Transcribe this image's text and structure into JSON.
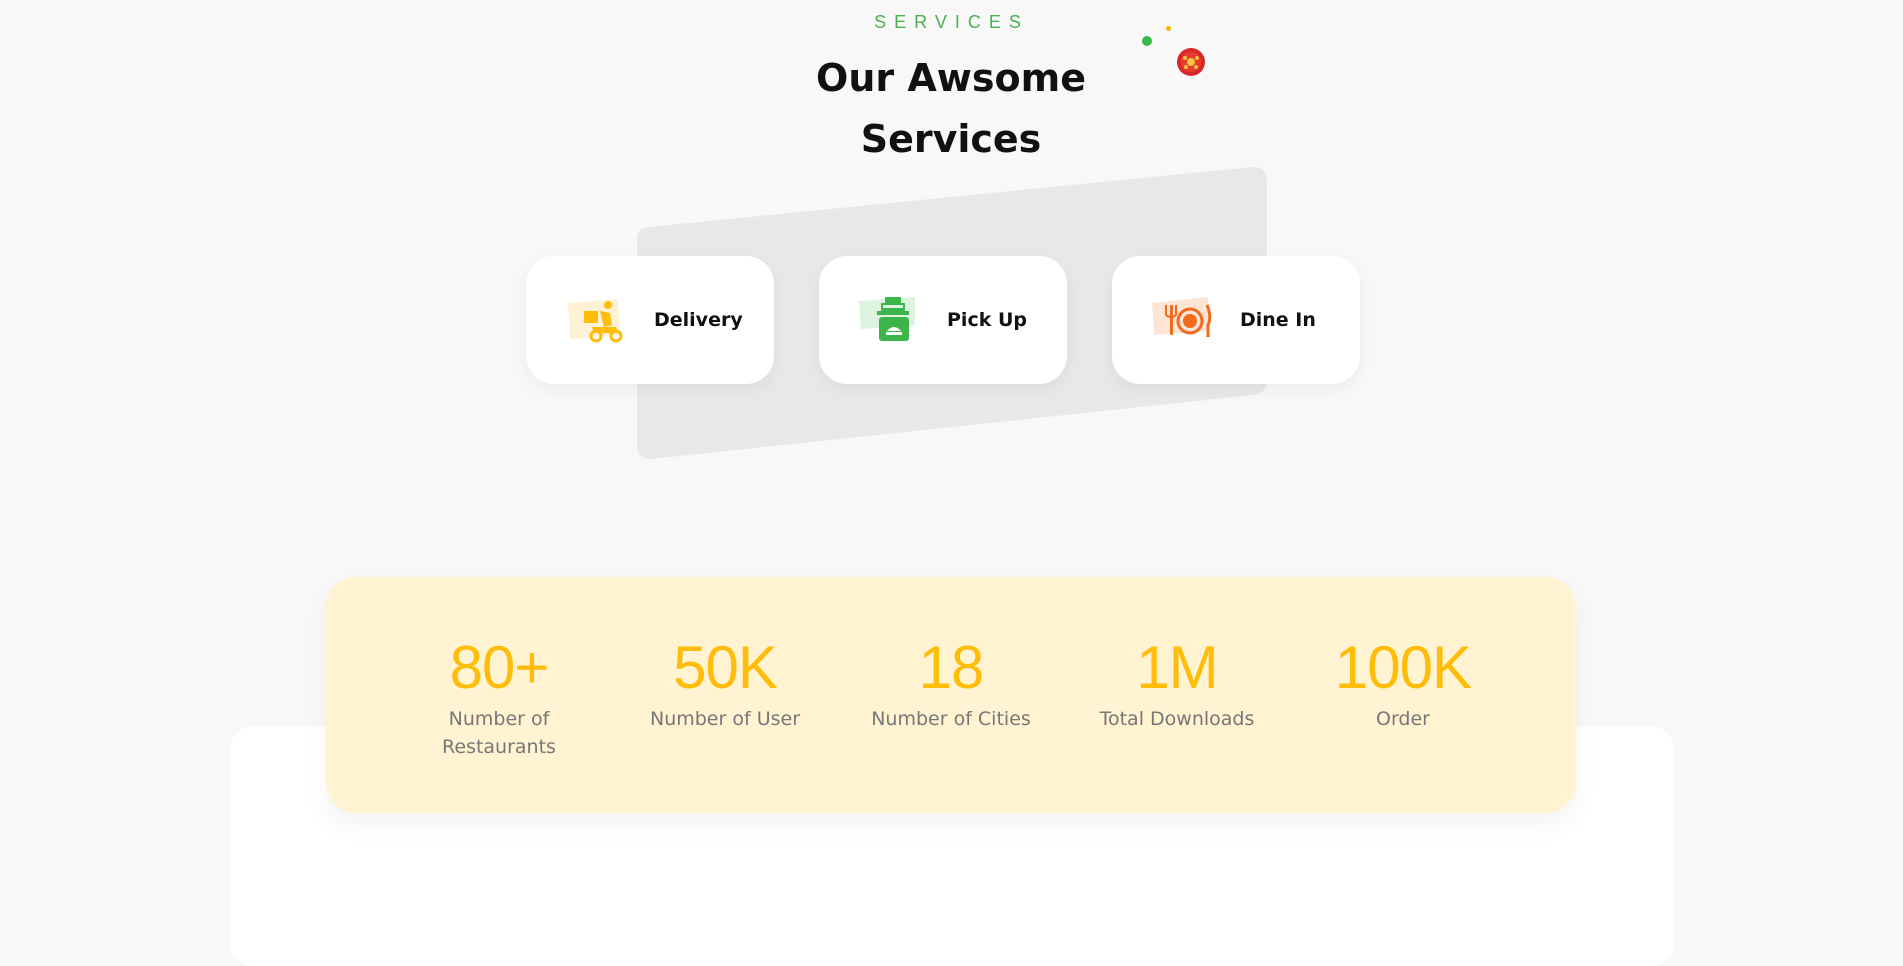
{
  "section": {
    "tag": "SERVICES",
    "title": "Our Awsome Services"
  },
  "services": [
    {
      "label": "Delivery",
      "icon": "delivery-scooter-icon",
      "color": "#ffbd0a"
    },
    {
      "label": "Pick Up",
      "icon": "pickup-bag-icon",
      "color": "#3cb54a"
    },
    {
      "label": "Dine In",
      "icon": "plate-cutlery-icon",
      "color": "#f26b1d"
    }
  ],
  "stats": [
    {
      "value": "80+",
      "label": "Number of Restaurants"
    },
    {
      "value": "50K",
      "label": "Number of User"
    },
    {
      "value": "18",
      "label": "Number of Cities"
    },
    {
      "value": "1M",
      "label": "Total Downloads"
    },
    {
      "value": "100K",
      "label": "Order"
    }
  ],
  "colors": {
    "accent_yellow": "#ffbd0a",
    "accent_green": "#3cb54a",
    "accent_orange": "#f26b1d",
    "stats_background": "#fff3d1"
  }
}
